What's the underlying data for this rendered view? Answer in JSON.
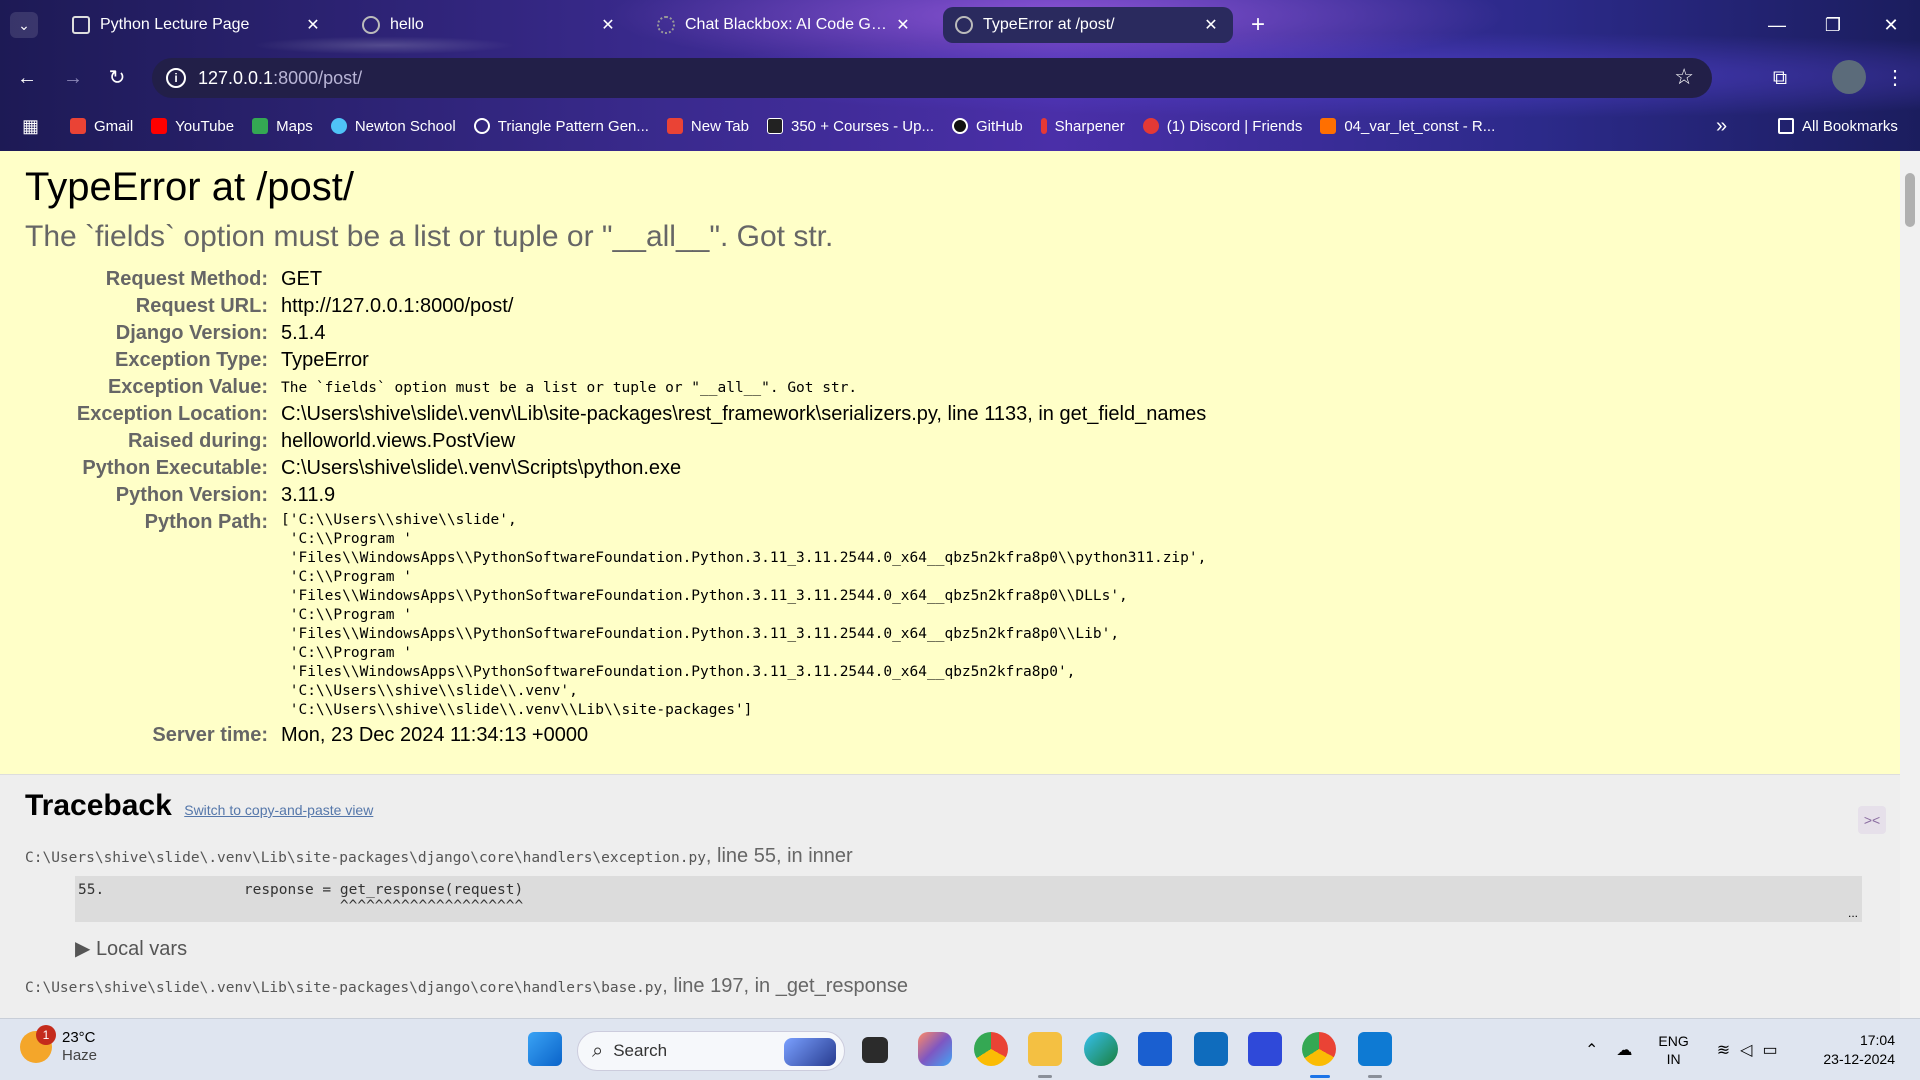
{
  "tabs": [
    {
      "title": "Python Lecture Page",
      "favicon": "book-icon"
    },
    {
      "title": "hello",
      "favicon": "globe-icon"
    },
    {
      "title": "Chat Blackbox: AI Code Genera",
      "favicon": "blackbox-icon"
    },
    {
      "title": "TypeError at /post/",
      "favicon": "globe-icon",
      "active": true
    }
  ],
  "address": {
    "host": "127.0.0.1",
    "path": ":8000/post/"
  },
  "bookmarks": [
    {
      "label": "Gmail",
      "color": "#ea4335"
    },
    {
      "label": "YouTube",
      "color": "#ff0000"
    },
    {
      "label": "Maps",
      "color": "#34a853"
    },
    {
      "label": "Newton School",
      "color": "#4fc3f7"
    },
    {
      "label": "Triangle Pattern Gen...",
      "color": "#ffffff"
    },
    {
      "label": "New Tab",
      "color": "#ea4335"
    },
    {
      "label": "350 + Courses - Up...",
      "color": "#222222"
    },
    {
      "label": "GitHub",
      "color": "#111111"
    },
    {
      "label": "Sharpener",
      "color": "#e53935"
    },
    {
      "label": "(1) Discord | Friends",
      "color": "#e53935"
    },
    {
      "label": "04_var_let_const - R...",
      "color": "#ff6f00"
    }
  ],
  "all_bookmarks_label": "All Bookmarks",
  "error": {
    "title": "TypeError at /post/",
    "subtitle": "The `fields` option must be a list or tuple or \"__all__\". Got str."
  },
  "meta": [
    {
      "label": "Request Method:",
      "value": "GET"
    },
    {
      "label": "Request URL:",
      "value": "http://127.0.0.1:8000/post/"
    },
    {
      "label": "Django Version:",
      "value": "5.1.4"
    },
    {
      "label": "Exception Type:",
      "value": "TypeError"
    },
    {
      "label": "Exception Value:",
      "value": "The `fields` option must be a list or tuple or \"__all__\". Got str."
    },
    {
      "label": "Exception Location:",
      "value": "C:\\Users\\shive\\slide\\.venv\\Lib\\site-packages\\rest_framework\\serializers.py, line 1133, in get_field_names"
    },
    {
      "label": "Raised during:",
      "value": "helloworld.views.PostView"
    },
    {
      "label": "Python Executable:",
      "value": "C:\\Users\\shive\\slide\\.venv\\Scripts\\python.exe"
    },
    {
      "label": "Python Version:",
      "value": "3.11.9"
    },
    {
      "label": "Python Path:",
      "value": "['C:\\\\Users\\\\shive\\\\slide',\n 'C:\\\\Program '\n 'Files\\\\WindowsApps\\\\PythonSoftwareFoundation.Python.3.11_3.11.2544.0_x64__qbz5n2kfra8p0\\\\python311.zip',\n 'C:\\\\Program '\n 'Files\\\\WindowsApps\\\\PythonSoftwareFoundation.Python.3.11_3.11.2544.0_x64__qbz5n2kfra8p0\\\\DLLs',\n 'C:\\\\Program '\n 'Files\\\\WindowsApps\\\\PythonSoftwareFoundation.Python.3.11_3.11.2544.0_x64__qbz5n2kfra8p0\\\\Lib',\n 'C:\\\\Program '\n 'Files\\\\WindowsApps\\\\PythonSoftwareFoundation.Python.3.11_3.11.2544.0_x64__qbz5n2kfra8p0',\n 'C:\\\\Users\\\\shive\\\\slide\\\\.venv',\n 'C:\\\\Users\\\\shive\\\\slide\\\\.venv\\\\Lib\\\\site-packages']"
    },
    {
      "label": "Server time:",
      "value": "Mon, 23 Dec 2024 11:34:13 +0000"
    }
  ],
  "traceback": {
    "heading": "Traceback",
    "switch_link": "Switch to copy-and-paste view",
    "frames": [
      {
        "file": "C:\\Users\\shive\\slide\\.venv\\Lib\\site-packages\\django\\core\\handlers\\exception.py",
        "where": ", line 55, in inner",
        "code": "55.                response = get_response(request)\n                              ^^^^^^^^^^^^^^^^^^^^^",
        "local_vars": "Local vars"
      },
      {
        "file": "C:\\Users\\shive\\slide\\.venv\\Lib\\site-packages\\django\\core\\handlers\\base.py",
        "where": ", line 197, in _get_response"
      }
    ],
    "dots": "..."
  },
  "taskbar": {
    "temp": "23°C",
    "weather": "Haze",
    "weather_badge": "1",
    "search_placeholder": "Search",
    "lang": "ENG",
    "region": "IN",
    "time": "17:04",
    "date": "23-12-2024"
  }
}
